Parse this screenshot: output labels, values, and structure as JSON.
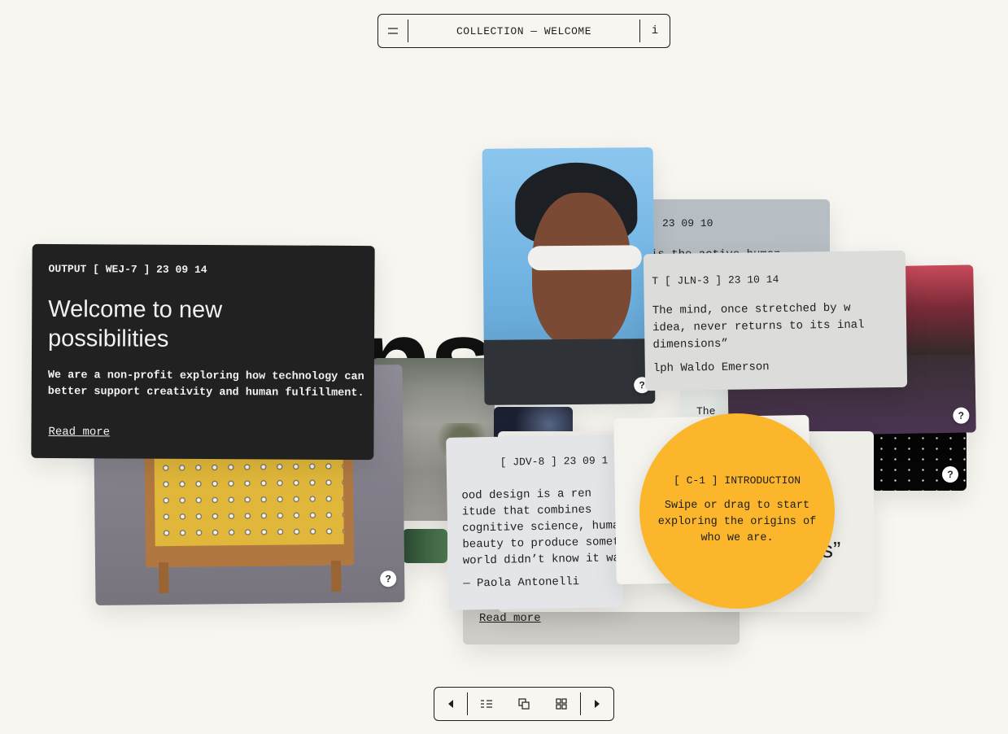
{
  "header": {
    "title": "COLLECTION — WELCOME",
    "info_label": "i"
  },
  "background_word": "ns",
  "cards": {
    "welcome": {
      "meta": "OUTPUT [ WEJ-7 ] 23 09 14",
      "heading": "Welcome to new possibilities",
      "body": "We are a non-profit exploring how technology can better support creativity and human fulfillment.",
      "link": "Read more"
    },
    "back_quote": {
      "meta": "23 09 10",
      "body": "is the active human"
    },
    "emerson": {
      "meta": "T [ JLN-3 ] 23 10 14",
      "quote": "The mind, once stretched by w idea, never returns to its inal dimensions”",
      "author": "lph Waldo Emerson"
    },
    "antonelli": {
      "meta": "[ JDV-8 ] 23 09 1",
      "quote": "ood design is a ren itude that combines cognitive science, huma beauty to produce somet world didn’t know it wa",
      "author": "— Paola Antonelli"
    },
    "under_link": {
      "link": "Read more"
    },
    "peek": {
      "text": "The"
    },
    "right_quote": {
      "line1": "!.",
      "line2": "s”"
    },
    "intro": {
      "meta": "[ C-1 ] INTRODUCTION",
      "body": "Swipe or drag to start exploring the origins of who we are."
    }
  },
  "help_icon_label": "?",
  "colors": {
    "background": "#f7f6f1",
    "dark_card": "#212121",
    "accent_yellow": "#fcb62b",
    "grey_card": "#d6d6d4"
  },
  "icons": [
    "menu-icon",
    "info-icon",
    "help-icon",
    "prev-icon",
    "list-view-icon",
    "stack-view-icon",
    "grid-view-icon",
    "next-icon"
  ]
}
